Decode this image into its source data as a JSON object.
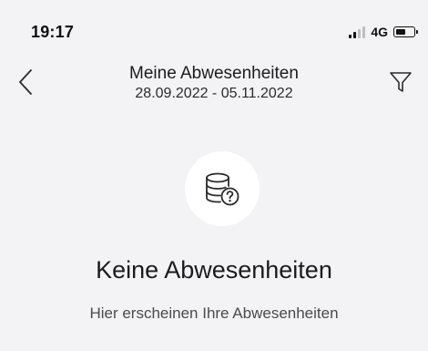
{
  "status_bar": {
    "time": "19:17",
    "network": "4G",
    "battery_level": 0.55
  },
  "nav": {
    "title": "Meine Abwesenheiten",
    "subtitle": "28.09.2022 - 05.11.2022",
    "back_icon": "chevron-left-icon",
    "filter_icon": "filter-funnel-icon"
  },
  "empty_state": {
    "icon": "database-question-icon",
    "title": "Keine Abwesenheiten",
    "subtitle": "Hier erscheinen Ihre Abwesenheiten"
  },
  "colors": {
    "background": "#f3f3f5",
    "text": "#1c1c1e",
    "icon": "#2a2a2c"
  }
}
